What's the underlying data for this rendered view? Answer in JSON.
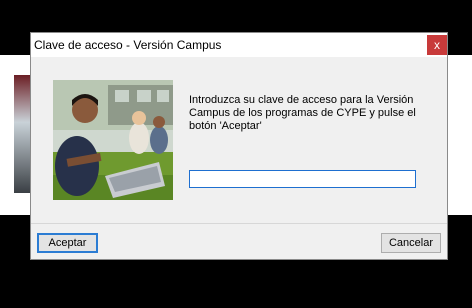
{
  "dialog": {
    "title": "Clave de acceso - Versión Campus",
    "close_glyph": "x",
    "prompt": "Introduzca su clave de acceso para la Versión Campus de los programas de CYPE y pulse el botón 'Aceptar'",
    "input_value": "",
    "ok_label": "Aceptar",
    "cancel_label": "Cancelar"
  },
  "colors": {
    "accent": "#1e6fd0",
    "close_button": "#c83a3a"
  },
  "icons": {
    "close": "close-icon"
  }
}
